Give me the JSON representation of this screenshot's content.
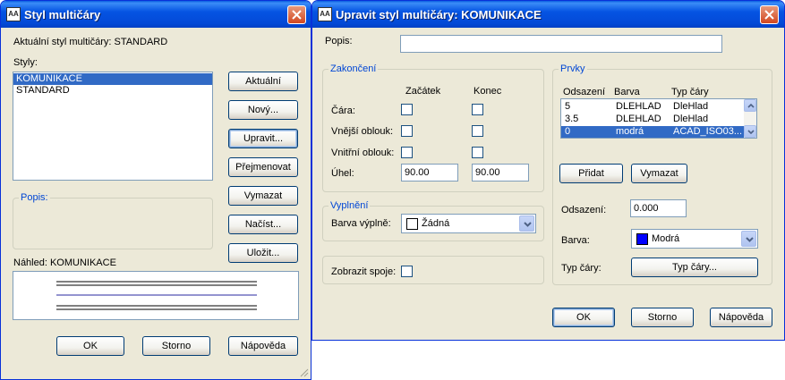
{
  "left": {
    "title": "Styl multičáry",
    "current_label": "Aktuální styl multičáry: STANDARD",
    "styles_label": "Styly:",
    "styles": [
      "KOMUNIKACE",
      "STANDARD"
    ],
    "desc_label": "Popis:",
    "preview_label": "Náhled: KOMUNIKACE",
    "buttons": {
      "current": "Aktuální",
      "new": "Nový...",
      "edit": "Upravit...",
      "rename": "Přejmenovat",
      "delete": "Vymazat",
      "load": "Načíst...",
      "save": "Uložit..."
    },
    "ok": "OK",
    "cancel": "Storno",
    "help": "Nápověda"
  },
  "right": {
    "title": "Upravit styl multičáry: KOMUNIKACE",
    "desc_label": "Popis:",
    "desc_value": "",
    "caps": {
      "title": "Zakončení",
      "start": "Začátek",
      "end": "Konec",
      "line": "Čára:",
      "outer_arc": "Vnější oblouk:",
      "inner_arc": "Vnitřní oblouk:",
      "angle": "Úhel:",
      "angle_start": "90.00",
      "angle_end": "90.00"
    },
    "fill": {
      "title": "Vyplnění",
      "label": "Barva výplně:",
      "value": "Žádná"
    },
    "joints_label": "Zobrazit spoje:",
    "elements": {
      "title": "Prvky",
      "headers": [
        "Odsazení",
        "Barva",
        "Typ čáry"
      ],
      "rows": [
        {
          "offset": "5",
          "color": "DLEHLAD",
          "ltype": "DleHlad"
        },
        {
          "offset": "3.5",
          "color": "DLEHLAD",
          "ltype": "DleHlad"
        },
        {
          "offset": "0",
          "color": "modrá",
          "ltype": "ACAD_ISO03..."
        }
      ],
      "add": "Přidat",
      "delete": "Vymazat",
      "offset_label": "Odsazení:",
      "offset_value": "0.000",
      "color_label": "Barva:",
      "color_value": "Modrá",
      "color_hex": "#0000ff",
      "ltype_label": "Typ čáry:",
      "ltype_button": "Typ čáry..."
    },
    "ok": "OK",
    "cancel": "Storno",
    "help": "Nápověda"
  }
}
